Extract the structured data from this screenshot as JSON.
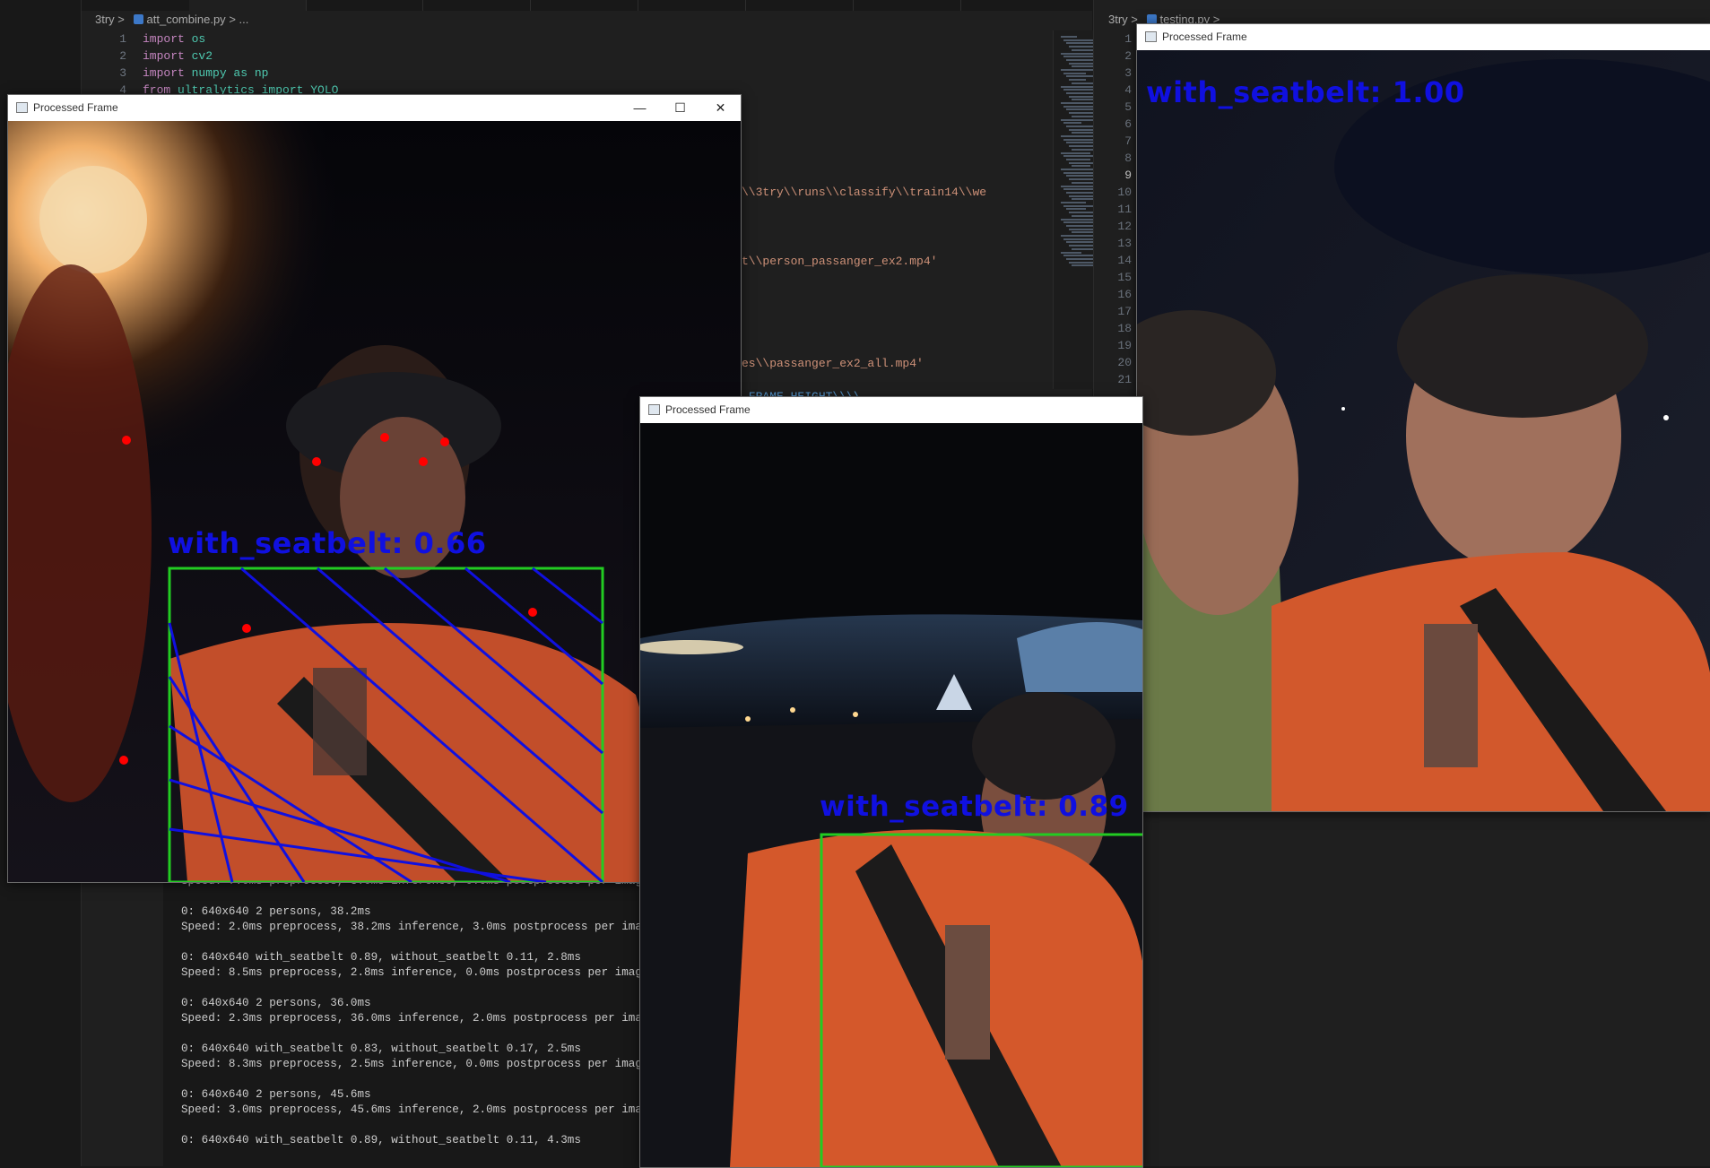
{
  "ide": {
    "left_breadcrumb": {
      "folder": "3try",
      "sep": ">",
      "file": "att_combine.py",
      "rest": "> ..."
    },
    "left_code": [
      {
        "num": "1",
        "kw": "import",
        "rest": " os"
      },
      {
        "num": "2",
        "kw": "import",
        "rest": " cv2"
      },
      {
        "num": "3",
        "kw": "import",
        "rest": " numpy as np"
      },
      {
        "num": "4",
        "kw": "from",
        "rest": " ultralytics import YOLO"
      }
    ],
    "code_fragments": [
      "\\\\3try\\\\runs\\\\classify\\\\train14\\\\we",
      "t\\\\person_passanger_ex2.mp4'",
      "es\\\\passanger_ex2_all.mp4'",
      "_FRAME_HEIGHT\\\\\\\\"
    ],
    "right_breadcrumb": {
      "folder": "3try",
      "sep": ">",
      "file": "testing.py",
      "rest": ">"
    },
    "right_line_numbers": [
      "1",
      "2",
      "3",
      "4",
      "5",
      "6",
      "7",
      "8",
      "9",
      "10",
      "11",
      "12",
      "13",
      "14",
      "15",
      "16",
      "17",
      "18",
      "19",
      "20",
      "21"
    ],
    "right_current_line": "9"
  },
  "terminal": {
    "lines": [
      "Speed: 7.0ms preprocess, 3.0ms inference, 0.0ms postprocess per image at shape (1, 3,",
      "",
      "0: 640x640 2 persons, 38.2ms",
      "Speed: 2.0ms preprocess, 38.2ms inference, 3.0ms postprocess per image at shape (1, 3,",
      "",
      "0: 640x640 with_seatbelt 0.89, without_seatbelt 0.11, 2.8ms",
      "Speed: 8.5ms preprocess, 2.8ms inference, 0.0ms postprocess per image at shape (1, 3,",
      "",
      "0: 640x640 2 persons, 36.0ms",
      "Speed: 2.3ms preprocess, 36.0ms inference, 2.0ms postprocess per image at shape (1, 3,",
      "",
      "0: 640x640 with_seatbelt 0.83, without_seatbelt 0.17, 2.5ms",
      "Speed: 8.3ms preprocess, 2.5ms inference, 0.0ms postprocess per image at shape (1, 3,",
      "",
      "0: 640x640 2 persons, 45.6ms",
      "Speed: 3.0ms preprocess, 45.6ms inference, 2.0ms postprocess per image at shape (1, 3,",
      "",
      "0: 640x640 with_seatbelt 0.89, without_seatbelt 0.11, 4.3ms"
    ]
  },
  "windows": {
    "left": {
      "title": "Processed Frame",
      "detection_label": "with_seatbelt: 0.66"
    },
    "middle": {
      "title": "Processed Frame",
      "detection_label": "with_seatbelt: 0.89"
    },
    "right": {
      "title": "Processed Frame",
      "detection_label": "with_seatbelt: 1.00"
    },
    "controls": {
      "minimize": "—",
      "maximize": "☐",
      "close": "✕"
    }
  },
  "colors": {
    "label_blue": "#1010e0",
    "box_green": "#22cc22",
    "keypoint_red": "#ff0000",
    "hoodie_orange": "#d2582c"
  }
}
